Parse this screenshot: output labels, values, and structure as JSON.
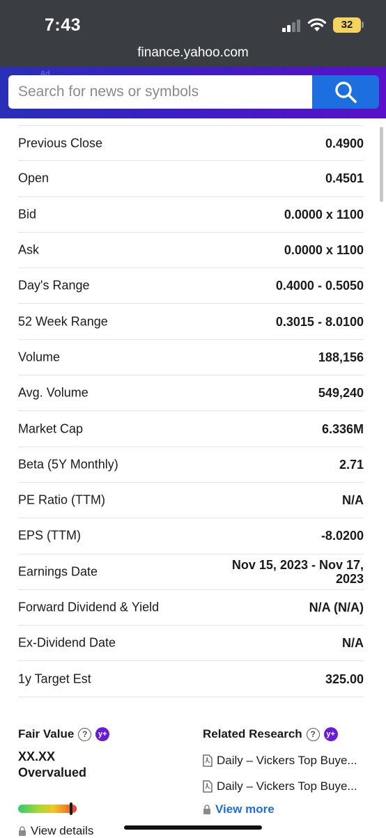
{
  "status_bar": {
    "time": "7:43",
    "battery": "32"
  },
  "browser": {
    "url": "finance.yahoo.com"
  },
  "search": {
    "placeholder": "Search for news or symbols",
    "ad_tag": "Ad"
  },
  "stats": [
    {
      "label": "Previous Close",
      "value": "0.4900"
    },
    {
      "label": "Open",
      "value": "0.4501"
    },
    {
      "label": "Bid",
      "value": "0.0000 x 1100"
    },
    {
      "label": "Ask",
      "value": "0.0000 x 1100"
    },
    {
      "label": "Day's Range",
      "value": "0.4000 - 0.5050"
    },
    {
      "label": "52 Week Range",
      "value": "0.3015 - 8.0100"
    },
    {
      "label": "Volume",
      "value": "188,156"
    },
    {
      "label": "Avg. Volume",
      "value": "549,240"
    },
    {
      "label": "Market Cap",
      "value": "6.336M"
    },
    {
      "label": "Beta (5Y Monthly)",
      "value": "2.71"
    },
    {
      "label": "PE Ratio (TTM)",
      "value": "N/A"
    },
    {
      "label": "EPS (TTM)",
      "value": "-8.0200"
    },
    {
      "label": "Earnings Date",
      "value": "Nov 15, 2023 - Nov 17, 2023"
    },
    {
      "label": "Forward Dividend & Yield",
      "value": "N/A (N/A)"
    },
    {
      "label": "Ex-Dividend Date",
      "value": "N/A"
    },
    {
      "label": "1y Target Est",
      "value": "325.00"
    }
  ],
  "fair_value": {
    "title": "Fair Value",
    "value": "XX.XX",
    "status": "Overvalued",
    "view_details": "View details",
    "badge": "y+"
  },
  "related_research": {
    "title": "Related Research",
    "items": [
      "Daily – Vickers Top Buye...",
      "Daily – Vickers Top Buye..."
    ],
    "view_more": "View more",
    "badge": "y+"
  },
  "colors": {
    "search_band": "#3b1fc4",
    "search_button": "#1d6fe0",
    "premium": "#6a1bd6",
    "link": "#1d6fe0"
  }
}
